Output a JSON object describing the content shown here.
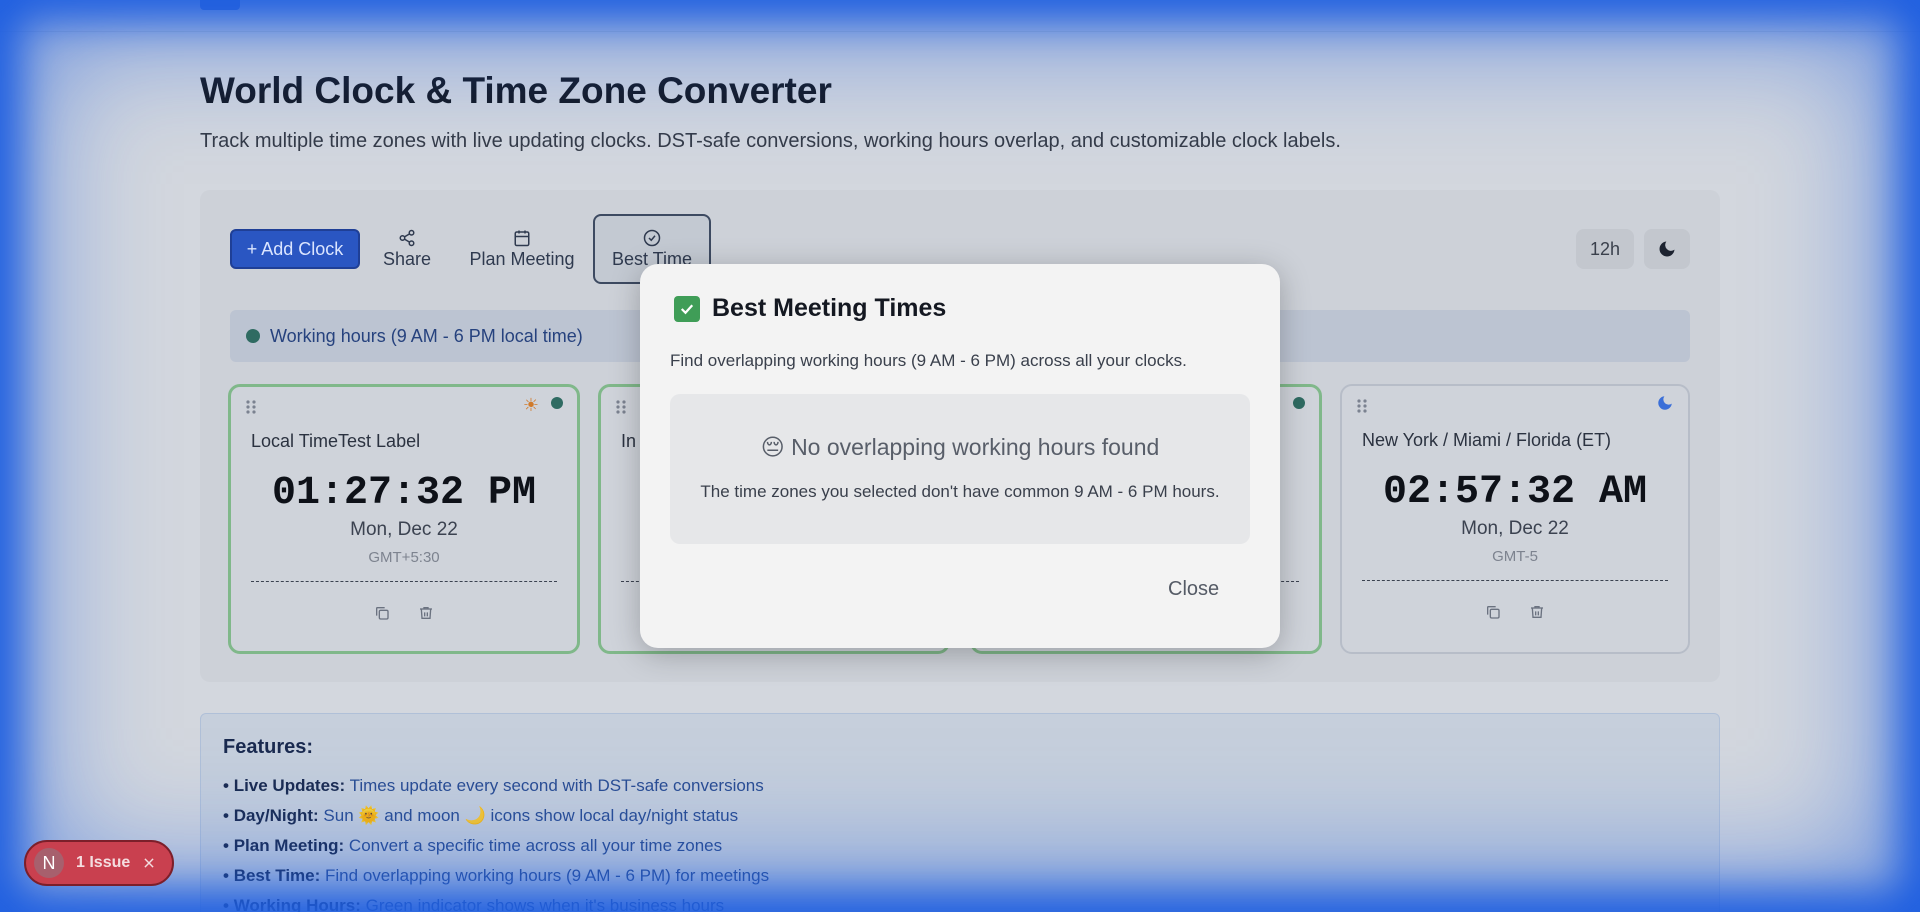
{
  "header": {
    "title": "World Clock & Time Zone Converter",
    "subtitle": "Track multiple time zones with live updating clocks. DST-safe conversions, working hours overlap, and customizable clock labels."
  },
  "toolbar": {
    "add_clock": "+ Add Clock",
    "share": "Share",
    "plan_meeting": "Plan Meeting",
    "best_time": "Best Time",
    "format_toggle": "12h"
  },
  "legend": {
    "text": "Working hours (9 AM - 6 PM local time)"
  },
  "clocks": [
    {
      "label": "Local TimeTest Label",
      "time": "01:27:32 PM",
      "date": "Mon, Dec 22",
      "tz": "GMT+5:30",
      "status": "day"
    },
    {
      "label": "In",
      "time": "",
      "date": "",
      "tz": "",
      "status": "day"
    },
    {
      "label": "",
      "time": "",
      "date": "",
      "tz": "",
      "status": "day"
    },
    {
      "label": "New York / Miami / Florida (ET)",
      "time": "02:57:32 AM",
      "date": "Mon, Dec 22",
      "tz": "GMT-5",
      "status": "night"
    }
  ],
  "features": {
    "heading": "Features:",
    "items": [
      {
        "title": "Live Updates:",
        "text": " Times update every second with DST-safe conversions"
      },
      {
        "title": "Day/Night:",
        "text": " Sun 🌞 and moon 🌙 icons show local day/night status"
      },
      {
        "title": "Plan Meeting:",
        "text": " Convert a specific time across all your time zones"
      },
      {
        "title": "Best Time:",
        "text": " Find overlapping working hours (9 AM - 6 PM) for meetings"
      },
      {
        "title": "Working Hours:",
        "text": " Green indicator shows when it's business hours"
      }
    ]
  },
  "modal": {
    "title": "Best Meeting Times",
    "description": "Find overlapping working hours (9 AM - 6 PM) across all your clocks.",
    "empty_title": "No overlapping working hours found",
    "empty_emoji": "😔",
    "empty_subtitle": "The time zones you selected don't have common 9 AM - 6 PM hours.",
    "close": "Close"
  },
  "issue_badge": {
    "initial": "N",
    "text": "1 Issue"
  }
}
